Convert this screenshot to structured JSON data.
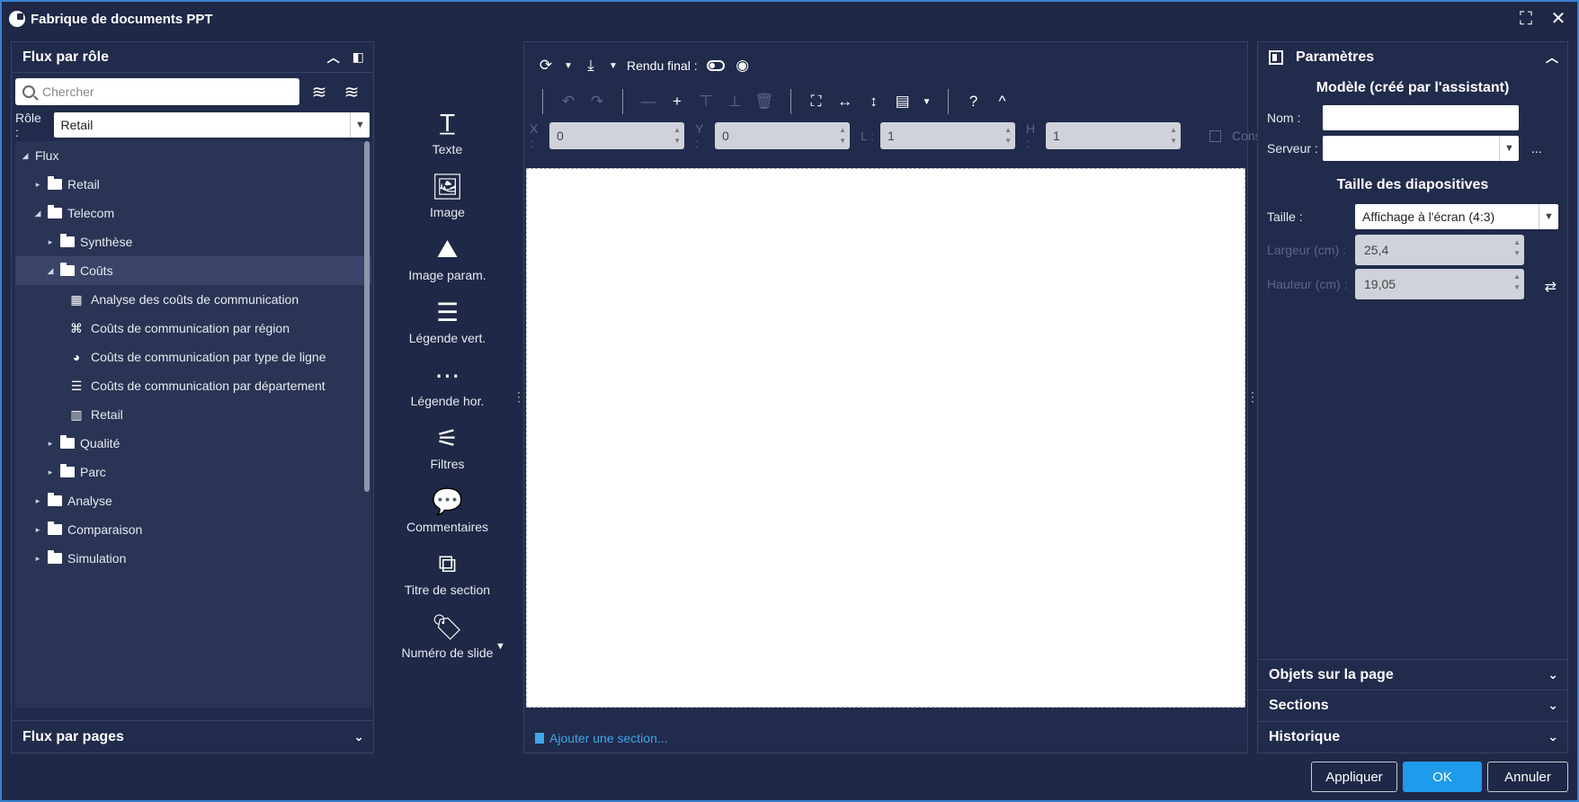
{
  "window": {
    "title": "Fabrique de documents PPT"
  },
  "left": {
    "header": "Flux par rôle",
    "search_placeholder": "Chercher",
    "role_label": "Rôle :",
    "role_value": "Retail",
    "tree": [
      {
        "label": "Flux",
        "level": 0,
        "twisty": "◢",
        "type": "root"
      },
      {
        "label": "Retail",
        "level": 1,
        "twisty": "▸",
        "type": "folder"
      },
      {
        "label": "Telecom",
        "level": 1,
        "twisty": "◢",
        "type": "folder"
      },
      {
        "label": "Synthèse",
        "level": 2,
        "twisty": "▸",
        "type": "folder"
      },
      {
        "label": "Coûts",
        "level": 2,
        "twisty": "◢",
        "type": "folder",
        "selected": true
      },
      {
        "label": "Analyse des coûts de communication",
        "level": 3,
        "type": "leaf",
        "icon": "grid-icon"
      },
      {
        "label": "Coûts de communication par région",
        "level": 3,
        "type": "leaf",
        "icon": "map-icon"
      },
      {
        "label": "Coûts de communication par type de ligne",
        "level": 3,
        "type": "leaf",
        "icon": "pie-chart-icon"
      },
      {
        "label": "Coûts de communication par département",
        "level": 3,
        "type": "leaf",
        "icon": "bar-chart-horizontal-icon"
      },
      {
        "label": "Retail",
        "level": 3,
        "type": "leaf",
        "icon": "bar-chart-icon"
      },
      {
        "label": "Qualité",
        "level": 2,
        "twisty": "▸",
        "type": "folder"
      },
      {
        "label": "Parc",
        "level": 2,
        "twisty": "▸",
        "type": "folder"
      },
      {
        "label": "Analyse",
        "level": 1,
        "twisty": "▸",
        "type": "folder"
      },
      {
        "label": "Comparaison",
        "level": 1,
        "twisty": "▸",
        "type": "folder"
      },
      {
        "label": "Simulation",
        "level": 1,
        "twisty": "▸",
        "type": "folder"
      }
    ],
    "footer": "Flux par pages"
  },
  "palette": [
    {
      "label": "Texte",
      "icon": "text-icon"
    },
    {
      "label": "Image",
      "icon": "image-icon"
    },
    {
      "label": "Image param.",
      "icon": "image-param-icon"
    },
    {
      "label": "Légende vert.",
      "icon": "legend-vertical-icon"
    },
    {
      "label": "Légende hor.",
      "icon": "legend-horizontal-icon"
    },
    {
      "label": "Filtres",
      "icon": "filter-icon"
    },
    {
      "label": "Commentaires",
      "icon": "comments-icon"
    },
    {
      "label": "Titre de section",
      "icon": "section-title-icon"
    },
    {
      "label": "Numéro de slide",
      "icon": "tag-icon"
    }
  ],
  "center": {
    "rendu_label": "Rendu final :",
    "coords": [
      {
        "label": "X :",
        "value": "0"
      },
      {
        "label": "Y :",
        "value": "0"
      },
      {
        "label": "L :",
        "value": "1"
      },
      {
        "label": "H :",
        "value": "1"
      }
    ],
    "conserv_label": "Conserv",
    "add_section": "Ajouter une section..."
  },
  "right": {
    "header": "Paramètres",
    "model_title": "Modèle (créé par l'assistant)",
    "nom_label": "Nom :",
    "nom_value": "",
    "serveur_label": "Serveur :",
    "serveur_value": "",
    "more": "...",
    "size_title": "Taille des diapositives",
    "taille_label": "Taille :",
    "taille_value": "Affichage à l'écran (4:3)",
    "largeur_label": "Largeur (cm) :",
    "largeur_value": "25,4",
    "hauteur_label": "Hauteur (cm) :",
    "hauteur_value": "19,05",
    "sections": [
      "Objets sur la page",
      "Sections",
      "Historique"
    ]
  },
  "buttons": {
    "apply": "Appliquer",
    "ok": "OK",
    "cancel": "Annuler"
  },
  "colors": {
    "background": "#1f2846",
    "accent": "#1e9bea",
    "link": "#3fa6e8"
  }
}
